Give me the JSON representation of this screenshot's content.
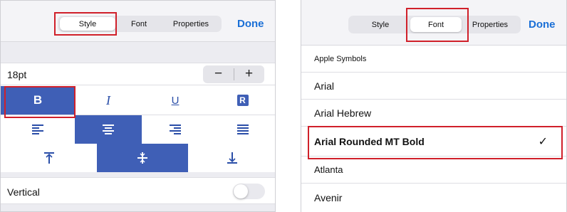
{
  "left_panel": {
    "tabs": [
      {
        "label": "Style",
        "selected": true
      },
      {
        "label": "Font",
        "selected": false
      },
      {
        "label": "Properties",
        "selected": false
      }
    ],
    "done_label": "Done",
    "font_size": "18pt",
    "stepper": {
      "decrement": "−",
      "increment": "+"
    },
    "style_row": [
      {
        "name": "bold",
        "glyph": "B",
        "active": true
      },
      {
        "name": "italic",
        "glyph": "I",
        "active": false
      },
      {
        "name": "underline",
        "glyph": "U",
        "active": false
      },
      {
        "name": "outline",
        "glyph": "R",
        "active": false
      }
    ],
    "align_row": [
      {
        "name": "align-left",
        "active": false
      },
      {
        "name": "align-center",
        "active": true
      },
      {
        "name": "align-right",
        "active": false
      },
      {
        "name": "justify",
        "active": false
      }
    ],
    "valign_row": [
      {
        "name": "align-top",
        "glyph": "⤒",
        "active": false
      },
      {
        "name": "align-middle",
        "glyph": "∓",
        "active": true
      },
      {
        "name": "align-bottom",
        "glyph": "⊥",
        "active": false
      }
    ],
    "vertical_label": "Vertical",
    "vertical_on": false
  },
  "right_panel": {
    "tabs": [
      {
        "label": "Style",
        "selected": false
      },
      {
        "label": "Font",
        "selected": true
      },
      {
        "label": "Properties",
        "selected": false
      }
    ],
    "done_label": "Done",
    "fonts": [
      {
        "name": "Apple Symbols",
        "selected": false
      },
      {
        "name": "Arial",
        "selected": false
      },
      {
        "name": "Arial Hebrew",
        "selected": false
      },
      {
        "name": "Arial Rounded MT Bold",
        "selected": true
      },
      {
        "name": "Atlanta",
        "selected": false
      },
      {
        "name": "Avenir",
        "selected": false
      }
    ],
    "checkmark": "✓"
  },
  "colors": {
    "accent_blue": "#1a6fd6",
    "active_fill": "#3f5fb6",
    "highlight_red": "#d0202a"
  }
}
